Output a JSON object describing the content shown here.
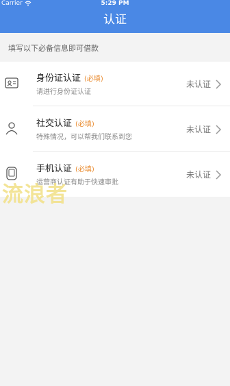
{
  "status_bar": {
    "carrier": "Carrier",
    "time": "5:29 PM"
  },
  "header": {
    "title": "认证"
  },
  "hint": "填写以下必备信息即可借款",
  "items": [
    {
      "title": "身份证认证",
      "required": "(必填)",
      "subtitle": "请进行身份证认证",
      "status": "未认证",
      "icon": "id-card-icon"
    },
    {
      "title": "社交认证",
      "required": "(必填)",
      "subtitle": "特殊情况，可以帮我们联系到您",
      "status": "未认证",
      "icon": "person-icon"
    },
    {
      "title": "手机认证",
      "required": "(必填)",
      "subtitle": "运营商认证有助于快速审批",
      "status": "未认证",
      "icon": "phone-icon"
    }
  ],
  "watermark": "流浪者",
  "colors": {
    "header": "#4a88e5",
    "required": "#e98a2d",
    "background": "#f3f3f3"
  }
}
